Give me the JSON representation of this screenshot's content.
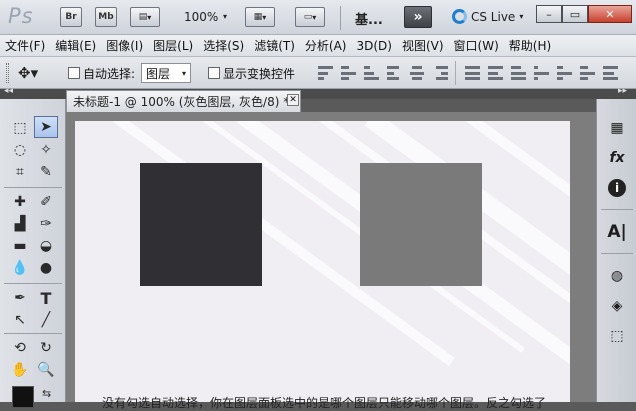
{
  "app": {
    "logo": "Ps"
  },
  "titlebar": {
    "br_label": "Br",
    "mb_label": "Mb",
    "zoom": "100%",
    "ji_label": "基...",
    "expand_label": "»",
    "cs_live": "CS Live"
  },
  "menu": [
    "文件(F)",
    "编辑(E)",
    "图像(I)",
    "图层(L)",
    "选择(S)",
    "滤镜(T)",
    "分析(A)",
    "3D(D)",
    "视图(V)",
    "窗口(W)",
    "帮助(H)"
  ],
  "options": {
    "auto_select_label": "自动选择:",
    "auto_select_value": "图层",
    "show_transform_label": "显示变换控件"
  },
  "document": {
    "tab_title": "未标题-1 @ 100% (灰色图层, 灰色/8) *",
    "caption": "没有勾选自动选择，你在图层面板选中的是哪个图层只能移动哪个图层。反之勾选了"
  },
  "colors": {
    "dark_square": "#303034",
    "gray_square": "#7a7a7a",
    "canvas_bg": "#f0eef3",
    "accent": "#1c7fcf"
  },
  "tools_icons": [
    "marquee-icon",
    "move-icon",
    "lasso-icon",
    "magic-wand-icon",
    "crop-icon",
    "eyedropper-icon",
    "healing-brush-icon",
    "brush-icon",
    "clone-stamp-icon",
    "history-brush-icon",
    "eraser-icon",
    "paint-bucket-icon",
    "blur-icon",
    "dodge-icon",
    "pen-icon",
    "type-icon",
    "path-selection-icon",
    "line-icon",
    "3d-rotate-icon",
    "3d-orbit-icon",
    "hand-icon",
    "zoom-icon"
  ],
  "right_dock_icons": [
    "histogram-icon",
    "fx-icon",
    "info-icon",
    "character-icon",
    "channels-icon",
    "layers-icon",
    "paths-icon"
  ]
}
